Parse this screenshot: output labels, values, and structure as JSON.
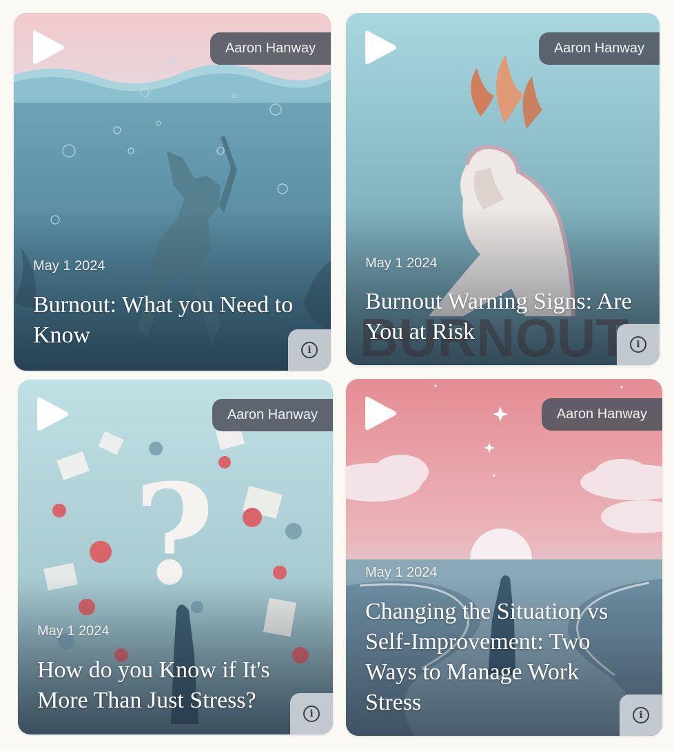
{
  "cards": [
    {
      "author": "Aaron Hanway",
      "date": "May 1 2024",
      "title": "Burnout: What you Need to Know",
      "info_icon": "info-icon",
      "play_icon": "play-icon"
    },
    {
      "author": "Aaron Hanway",
      "date": "May 1 2024",
      "title": "Burnout Warning Signs: Are You at Risk",
      "info_icon": "info-icon",
      "play_icon": "play-icon"
    },
    {
      "author": "Aaron Hanway",
      "date": "May 1 2024",
      "title": "How do you Know if It's More Than Just Stress?",
      "info_icon": "info-icon",
      "play_icon": "play-icon"
    },
    {
      "author": "Aaron Hanway",
      "date": "May 1 2024",
      "title": "Changing the Situation vs Self-Improvement: Two Ways to Manage Work Stress",
      "info_icon": "info-icon",
      "play_icon": "play-icon"
    }
  ],
  "colors": {
    "page_background": "#fbf9f4",
    "author_badge": "#4e5460",
    "info_badge": "#cdd2d8"
  }
}
